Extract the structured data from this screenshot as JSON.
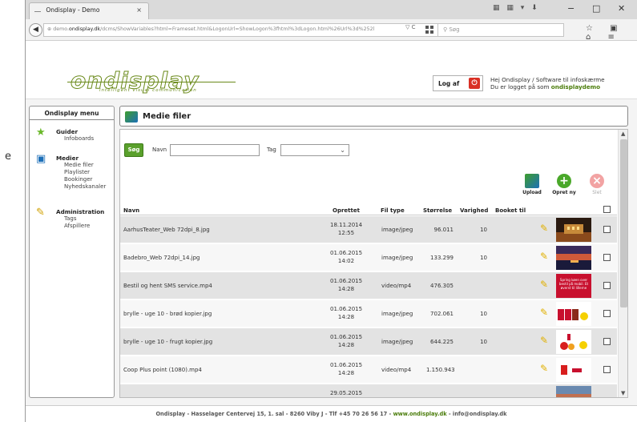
{
  "edge_text": "e",
  "browser": {
    "tab_title": "Ondisplay - Demo",
    "tab_close": "×",
    "toolbar_icons": "▦ ▦ ▾ ⬇",
    "minimize": "−",
    "maximize": "□",
    "close": "✕",
    "back": "◀",
    "url_prefix": "demo.",
    "url_domain": "ondisplay.dk",
    "url_rest": "/dcms/ShowVariables?html=Frameset.html&LogonUrl=ShowLogon%3fhtml%3dLogon.html%26Url%3d%252l",
    "url_controls": "▽ C",
    "search_placeholder": "Søg",
    "nav_icons": "☆ ▣ ⌂ ≡"
  },
  "header": {
    "logo": "ondisplay",
    "tagline": "intelligent visual communication",
    "logout_label": "Log af",
    "logout_icon": "⏻",
    "greeting_line1": "Hej Ondisplay /  Software til infoskærme",
    "greeting_line2_prefix": "Du er logget på som ",
    "greeting_user": "ondisplaydemo"
  },
  "sidebar": {
    "title": "Ondisplay menu",
    "groups": [
      {
        "icon": "star-icon",
        "glyph": "★",
        "label": "Guider",
        "items": [
          "Infoboards"
        ]
      },
      {
        "icon": "media-icon",
        "glyph": "▣",
        "label": "Medier",
        "items": [
          "Medie filer",
          "Playlister",
          "Bookinger",
          "Nyhedskanaler"
        ]
      },
      {
        "icon": "tools-icon",
        "glyph": "✎",
        "label": "Administration",
        "items": [
          "Tags",
          "Afspillere"
        ]
      }
    ]
  },
  "main": {
    "title": "Medie filer",
    "search_button": "Søg",
    "name_label": "Navn",
    "tag_label": "Tag",
    "name_value": "",
    "tag_value": "",
    "actions": {
      "upload": "Upload",
      "create": "Opret ny",
      "delete": "Slet"
    },
    "columns": [
      "Navn",
      "Oprettet",
      "Fil type",
      "Størrelse",
      "Varighed",
      "Booket til"
    ],
    "rows": [
      {
        "name": "AarhusTeater_Web 72dpi_8.jpg",
        "date": "18.11.2014",
        "time": "12:55",
        "type": "image/jpeg",
        "size": "96.011",
        "duration": "10"
      },
      {
        "name": "Badebro_Web 72dpi_14.jpg",
        "date": "01.06.2015",
        "time": "14:02",
        "type": "image/jpeg",
        "size": "133.299",
        "duration": "10"
      },
      {
        "name": "Bestil og hent SMS service.mp4",
        "date": "01.06.2015",
        "time": "14:28",
        "type": "video/mp4",
        "size": "476.305",
        "duration": ""
      },
      {
        "name": "brylle - uge 10 - brød kopier.jpg",
        "date": "01.06.2015",
        "time": "14:28",
        "type": "image/jpeg",
        "size": "702.061",
        "duration": "10"
      },
      {
        "name": "brylle - uge 10 - frugt kopier.jpg",
        "date": "01.06.2015",
        "time": "14:28",
        "type": "image/jpeg",
        "size": "644.225",
        "duration": "10"
      },
      {
        "name": "Coop Plus point (1080).mp4",
        "date": "01.06.2015",
        "time": "14:28",
        "type": "video/mp4",
        "size": "1.150.943",
        "duration": ""
      },
      {
        "name": "",
        "date": "29.05.2015",
        "time": "",
        "type": "",
        "size": "",
        "duration": ""
      }
    ],
    "thumb_texts": [
      "Spring køen over bestil på mobil. Et øverst til lillerne"
    ]
  },
  "footer": {
    "prefix": "Ondisplay - Hasselager Centervej 15, 1. sal - 8260 Viby J - Tlf +45 70 26 56 17 - ",
    "web": "www.ondisplay.dk",
    "suffix": " - info@ondisplay.dk"
  }
}
